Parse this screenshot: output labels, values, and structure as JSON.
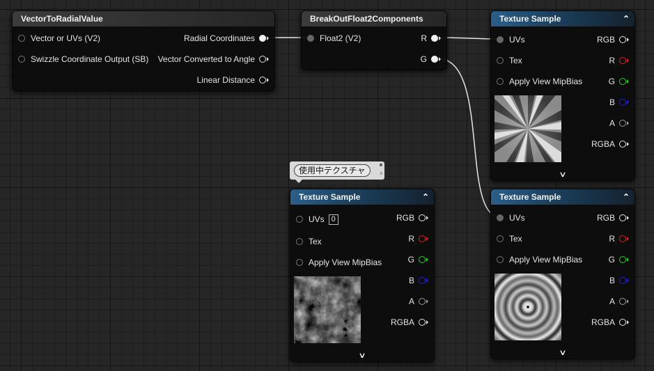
{
  "nodes": {
    "vector_to_radial": {
      "title": "VectorToRadialValue",
      "inputs": [
        "Vector or UVs (V2)",
        "Swizzle Coordinate Output (SB)"
      ],
      "outputs": [
        "Radial Coordinates",
        "Vector Converted to Angle",
        "Linear Distance"
      ]
    },
    "break_out": {
      "title": "BreakOutFloat2Components",
      "inputs": [
        "Float2 (V2)"
      ],
      "outputs": [
        "R",
        "G"
      ]
    },
    "tex_sample_1": {
      "title": "Texture Sample",
      "inputs": [
        "UVs",
        "Tex",
        "Apply View MipBias"
      ],
      "outputs": [
        "RGB",
        "R",
        "G",
        "B",
        "A",
        "RGBA"
      ],
      "preview_icon": "radial-burst-texture",
      "expand_icon": "chevron-down-icon"
    },
    "tex_sample_2": {
      "title": "Texture Sample",
      "uv_value": "0",
      "inputs": [
        "UVs",
        "Tex",
        "Apply View MipBias"
      ],
      "outputs": [
        "RGB",
        "R",
        "G",
        "B",
        "A",
        "RGBA"
      ],
      "preview_icon": "noise-texture",
      "expand_icon": "chevron-down-icon"
    },
    "tex_sample_3": {
      "title": "Texture Sample",
      "inputs": [
        "UVs",
        "Tex",
        "Apply View MipBias"
      ],
      "outputs": [
        "RGB",
        "R",
        "G",
        "B",
        "A",
        "RGBA"
      ],
      "preview_icon": "concentric-rings-texture",
      "expand_icon": "chevron-down-icon"
    }
  },
  "comment_bubble": {
    "text": "使用中テクスチャ"
  },
  "colors": {
    "header_blue": "#2a5f8a",
    "pin_red": "#e02020",
    "pin_green": "#20d020",
    "pin_blue": "#2020e0",
    "wire": "#e6e6e6"
  }
}
